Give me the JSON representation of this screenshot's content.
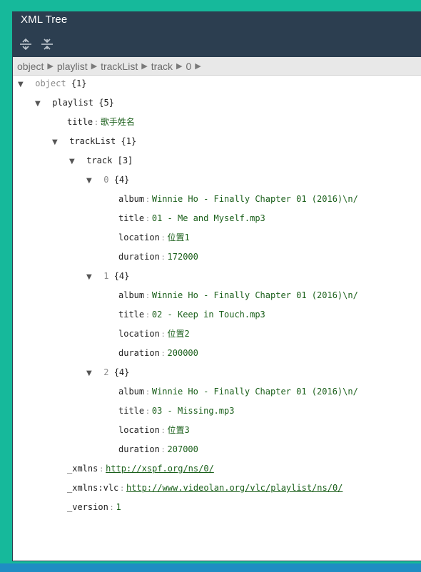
{
  "window": {
    "title": "XML Tree"
  },
  "toolbar": {
    "expand_icon": "expand-all-icon",
    "collapse_icon": "collapse-all-icon"
  },
  "breadcrumb": {
    "items": [
      "object",
      "playlist",
      "trackList",
      "track",
      "0"
    ]
  },
  "tree": {
    "root_key": "object",
    "root_count": "{1}",
    "playlist_key": "playlist",
    "playlist_count": "{5}",
    "title_key": "title",
    "title_val": "歌手姓名",
    "tracklist_key": "trackList",
    "tracklist_count": "{1}",
    "track_key": "track",
    "track_count": "[3]",
    "tracks": [
      {
        "index": "0",
        "count": "{4}",
        "album_key": "album",
        "album": "Winnie Ho - Finally Chapter 01 (2016)\\n/",
        "title_key": "title",
        "title": "01 - Me and Myself.mp3",
        "location_key": "location",
        "location": "位置1",
        "duration_key": "duration",
        "duration": "172000"
      },
      {
        "index": "1",
        "count": "{4}",
        "album_key": "album",
        "album": "Winnie Ho - Finally Chapter 01 (2016)\\n/",
        "title_key": "title",
        "title": "02 - Keep in Touch.mp3",
        "location_key": "location",
        "location": "位置2",
        "duration_key": "duration",
        "duration": "200000"
      },
      {
        "index": "2",
        "count": "{4}",
        "album_key": "album",
        "album": "Winnie Ho - Finally Chapter 01 (2016)\\n/",
        "title_key": "title",
        "title": "03 - Missing.mp3",
        "location_key": "location",
        "location": "位置3",
        "duration_key": "duration",
        "duration": "207000"
      }
    ],
    "xmlns_key": "_xmlns",
    "xmlns_val": "http://xspf.org/ns/0/",
    "xmlnsvlc_key": "_xmlns:vlc",
    "xmlnsvlc_val": "http://www.videolan.org/vlc/playlist/ns/0/",
    "version_key": "_version",
    "version_val": "1"
  },
  "colors": {
    "title_bar": "#2c3e50",
    "background": "#16b99b",
    "value_green": "#1a5f1a"
  }
}
